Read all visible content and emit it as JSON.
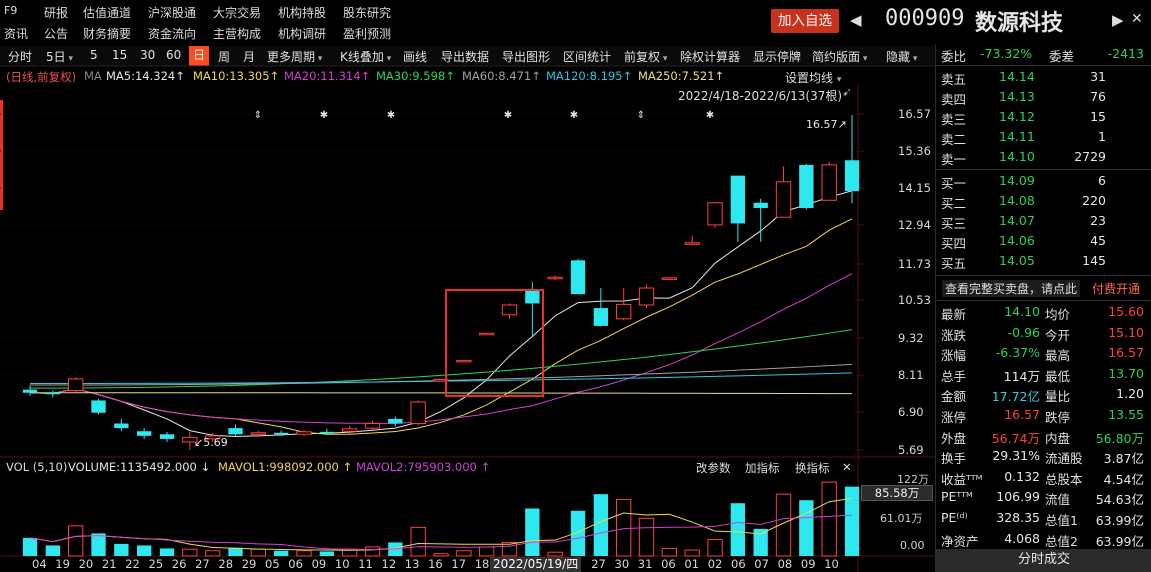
{
  "top_menu": {
    "f9": "F9",
    "row1": [
      "研报",
      "估值通道",
      "沪深股通",
      "大宗交易",
      "机构持股",
      "股东研究"
    ],
    "row2": [
      "资讯",
      "公告",
      "财务摘要",
      "资金流向",
      "主营构成",
      "机构调研",
      "盈利预测"
    ]
  },
  "header": {
    "add_watch_label": "加入自选",
    "stock_code": "000909",
    "stock_name": "数源科技",
    "prev_arrow": "◀",
    "next_arrow": "▶",
    "close_x": "✕"
  },
  "toolbar": {
    "items": [
      "分时",
      "5日",
      "5",
      "15",
      "30",
      "60",
      "日",
      "周",
      "月",
      "更多周期",
      "K线叠加",
      "画线",
      "导出数据",
      "导出图形",
      "区间统计",
      "前复权",
      "除权计算器",
      "显示停牌",
      "简约版面",
      "隐藏"
    ],
    "active_index": 6
  },
  "ma_legend": {
    "mode": "(日线,前复权)",
    "ma_label": "MA",
    "items": [
      {
        "text": "MA5:14.324↑",
        "color": "#e6e6e6"
      },
      {
        "text": "MA10:13.305↑",
        "color": "#f2d84a"
      },
      {
        "text": "MA20:11.314↑",
        "color": "#d43fd2"
      },
      {
        "text": "MA30:9.598↑",
        "color": "#2ed35a"
      },
      {
        "text": "MA60:8.471↑",
        "color": "#a0a0a0"
      },
      {
        "text": "MA120:8.195↑",
        "color": "#2ec6e8"
      },
      {
        "text": "MA250:7.521↑",
        "color": "#e8e07a"
      }
    ],
    "settings_label": "设置均线",
    "range_label": "2022/4/18-2022/6/13(37根)"
  },
  "price_axis": [
    "16.57",
    "15.36",
    "14.15",
    "12.94",
    "11.73",
    "10.53",
    "9.32",
    "8.11",
    "6.90",
    "5.69"
  ],
  "annotations": {
    "high": "16.57↗",
    "low": "5.69"
  },
  "volume": {
    "legend_label": "VOL (5,10)",
    "volume_text": "VOLUME:1135492.000 ↓",
    "mavol1_text": "MAVOL1:998092.000 ↑",
    "mavol2_text": "MAVOL2:795903.000 ↑",
    "buttons": [
      "改参数",
      "加指标",
      "换指标",
      "✕"
    ],
    "axis": [
      "122万",
      "85.58万",
      "61.01万",
      "0.00"
    ]
  },
  "date_axis": [
    "04",
    "19",
    "20",
    "21",
    "22",
    "25",
    "26",
    "27",
    "28",
    "29",
    "05",
    "06",
    "09",
    "10",
    "11",
    "12",
    "13",
    "16",
    "17",
    "18",
    "19",
    "2022/05/19/四",
    "25",
    "26",
    "27",
    "30",
    "31",
    "06",
    "01",
    "02",
    "06",
    "07",
    "08",
    "09",
    "10"
  ],
  "chart_data": {
    "type": "candlestick",
    "range": "2022/4/18-2022/6/13",
    "ylim": [
      5.69,
      16.57
    ],
    "candles": [
      {
        "o": 7.65,
        "c": 7.55,
        "h": 7.78,
        "l": 7.45,
        "v": 24
      },
      {
        "o": 7.55,
        "c": 7.5,
        "h": 7.62,
        "l": 7.4,
        "v": 14
      },
      {
        "o": 7.62,
        "c": 8.0,
        "h": 8.05,
        "l": 7.55,
        "v": 40
      },
      {
        "o": 7.3,
        "c": 6.9,
        "h": 7.35,
        "l": 6.85,
        "v": 30
      },
      {
        "o": 6.55,
        "c": 6.4,
        "h": 6.7,
        "l": 6.3,
        "v": 16
      },
      {
        "o": 6.3,
        "c": 6.15,
        "h": 6.4,
        "l": 6.05,
        "v": 14
      },
      {
        "o": 6.2,
        "c": 6.05,
        "h": 6.28,
        "l": 5.95,
        "v": 10
      },
      {
        "o": 5.95,
        "c": 6.1,
        "h": 6.28,
        "l": 5.69,
        "v": 9
      },
      {
        "o": 6.05,
        "c": 6.15,
        "h": 6.25,
        "l": 5.95,
        "v": 7
      },
      {
        "o": 6.4,
        "c": 6.2,
        "h": 6.52,
        "l": 6.15,
        "v": 11
      },
      {
        "o": 6.2,
        "c": 6.25,
        "h": 6.32,
        "l": 6.12,
        "v": 9
      },
      {
        "o": 6.25,
        "c": 6.2,
        "h": 6.32,
        "l": 6.15,
        "v": 7
      },
      {
        "o": 6.2,
        "c": 6.28,
        "h": 6.35,
        "l": 6.15,
        "v": 7
      },
      {
        "o": 6.28,
        "c": 6.25,
        "h": 6.38,
        "l": 6.2,
        "v": 6
      },
      {
        "o": 6.3,
        "c": 6.38,
        "h": 6.48,
        "l": 6.22,
        "v": 9
      },
      {
        "o": 6.4,
        "c": 6.55,
        "h": 6.65,
        "l": 6.35,
        "v": 12
      },
      {
        "o": 6.7,
        "c": 6.55,
        "h": 6.78,
        "l": 6.45,
        "v": 18
      },
      {
        "o": 6.55,
        "c": 7.25,
        "h": 7.3,
        "l": 6.5,
        "v": 38
      },
      {
        "o": 7.98,
        "c": 7.98,
        "h": 7.98,
        "l": 7.98,
        "v": 3
      },
      {
        "o": 8.6,
        "c": 8.6,
        "h": 8.6,
        "l": 8.6,
        "v": 7
      },
      {
        "o": 9.48,
        "c": 9.48,
        "h": 9.48,
        "l": 9.48,
        "v": 12
      },
      {
        "o": 10.08,
        "c": 10.4,
        "h": 10.45,
        "l": 9.95,
        "v": 18
      },
      {
        "o": 10.88,
        "c": 10.45,
        "h": 11.15,
        "l": 9.35,
        "v": 63
      },
      {
        "o": 11.25,
        "c": 11.3,
        "h": 11.35,
        "l": 11.2,
        "v": 5
      },
      {
        "o": 11.85,
        "c": 10.75,
        "h": 11.9,
        "l": 10.75,
        "v": 60
      },
      {
        "o": 10.3,
        "c": 9.72,
        "h": 10.95,
        "l": 9.7,
        "v": 82
      },
      {
        "o": 9.95,
        "c": 10.42,
        "h": 10.95,
        "l": 9.9,
        "v": 75
      },
      {
        "o": 10.4,
        "c": 10.95,
        "h": 11.05,
        "l": 10.3,
        "v": 50
      },
      {
        "o": 11.28,
        "c": 11.28,
        "h": 11.3,
        "l": 11.2,
        "v": 10
      },
      {
        "o": 12.42,
        "c": 12.42,
        "h": 12.65,
        "l": 12.35,
        "v": 8
      },
      {
        "o": 13.0,
        "c": 13.72,
        "h": 13.72,
        "l": 12.9,
        "v": 22
      },
      {
        "o": 14.6,
        "c": 13.05,
        "h": 14.6,
        "l": 12.45,
        "v": 70
      },
      {
        "o": 13.72,
        "c": 13.55,
        "h": 13.85,
        "l": 12.45,
        "v": 36
      },
      {
        "o": 13.25,
        "c": 14.4,
        "h": 14.9,
        "l": 13.25,
        "v": 82
      },
      {
        "o": 14.95,
        "c": 13.55,
        "h": 14.98,
        "l": 13.5,
        "v": 74
      },
      {
        "o": 13.8,
        "c": 14.95,
        "h": 15.05,
        "l": 13.8,
        "v": 98
      },
      {
        "o": 15.1,
        "c": 14.1,
        "h": 16.57,
        "l": 13.7,
        "v": 92
      }
    ]
  },
  "quote": {
    "wei_bi": {
      "label": "委比",
      "value": "-73.32%"
    },
    "wei_cha": {
      "label": "委差",
      "value": "-2413"
    },
    "asks": [
      {
        "label": "卖五",
        "price": "14.14",
        "vol": "31"
      },
      {
        "label": "卖四",
        "price": "14.13",
        "vol": "76"
      },
      {
        "label": "卖三",
        "price": "14.12",
        "vol": "15"
      },
      {
        "label": "卖二",
        "price": "14.11",
        "vol": "1"
      },
      {
        "label": "卖一",
        "price": "14.10",
        "vol": "2729"
      }
    ],
    "bids": [
      {
        "label": "买一",
        "price": "14.09",
        "vol": "6"
      },
      {
        "label": "买二",
        "price": "14.08",
        "vol": "220"
      },
      {
        "label": "买三",
        "price": "14.07",
        "vol": "23"
      },
      {
        "label": "买四",
        "price": "14.06",
        "vol": "45"
      },
      {
        "label": "买五",
        "price": "14.05",
        "vol": "145"
      }
    ],
    "promo_text": "查看完整买卖盘，请点此",
    "promo_link": "付费开通",
    "stats": [
      {
        "l1": "最新",
        "v1": "14.10",
        "c1": "green",
        "l2": "均价",
        "v2": "15.60",
        "c2": "red"
      },
      {
        "l1": "涨跌",
        "v1": "-0.96",
        "c1": "green",
        "l2": "今开",
        "v2": "15.10",
        "c2": "red"
      },
      {
        "l1": "涨幅",
        "v1": "-6.37%",
        "c1": "green",
        "l2": "最高",
        "v2": "16.57",
        "c2": "red"
      },
      {
        "l1": "总手",
        "v1": "114万",
        "c1": "white",
        "l2": "最低",
        "v2": "13.70",
        "c2": "green"
      },
      {
        "l1": "金额",
        "v1": "17.72亿",
        "c1": "cyan",
        "l2": "量比",
        "v2": "1.20",
        "c2": "white"
      },
      {
        "l1": "涨停",
        "v1": "16.57",
        "c1": "red",
        "l2": "跌停",
        "v2": "13.55",
        "c2": "green"
      },
      {
        "l1": "外盘",
        "v1": "56.74万",
        "c1": "red",
        "l2": "内盘",
        "v2": "56.80万",
        "c2": "green"
      },
      {
        "l1": "换手",
        "v1": "29.31%",
        "c1": "white",
        "l2": "流通股",
        "v2": "3.87亿",
        "c2": "white"
      },
      {
        "l1": "收益ᵀᵀᴹ",
        "v1": "0.132",
        "c1": "white",
        "l2": "总股本",
        "v2": "4.54亿",
        "c2": "white"
      },
      {
        "l1": "PEᵀᵀᴹ",
        "v1": "106.99",
        "c1": "white",
        "l2": "流值",
        "v2": "54.63亿",
        "c2": "white"
      },
      {
        "l1": "PE⁽ᵈ⁾",
        "v1": "328.35",
        "c1": "white",
        "l2": "总值1",
        "v2": "63.99亿",
        "c2": "white"
      },
      {
        "l1": "净资产",
        "v1": "4.068",
        "c1": "white",
        "l2": "总值2",
        "v2": "63.99亿",
        "c2": "white"
      }
    ],
    "bottom_tab": "分时成交"
  },
  "colors": {
    "up": "#ff4040",
    "down": "#2ee8ef",
    "accent": "#ff4b1f",
    "highlight_box": "#e8302c"
  }
}
